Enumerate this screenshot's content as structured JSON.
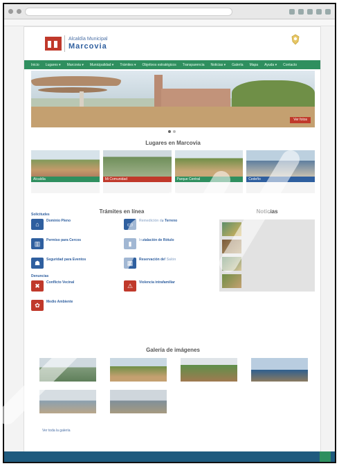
{
  "colors": {
    "nav_green": "#2f8f5f",
    "brand_red": "#c0392b",
    "brand_blue": "#2f5f9f",
    "footer_blue": "#1f5a7e"
  },
  "icons": {
    "logo": "building-icon",
    "crest": "crest-icon",
    "watermark": "watermark"
  },
  "header": {
    "subtitle": "Alcaldía Municipal",
    "title": "Marcovia"
  },
  "nav": {
    "items": [
      "Inicio",
      "Lugares ▾",
      "Marcovia ▾",
      "Municipalidad ▾",
      "Trámites ▾",
      "Objetivos estratégicos",
      "Transparencia",
      "Noticias ▾",
      "Galería",
      "Mapa",
      "Ayuda ▾",
      "Contacto"
    ]
  },
  "hero": {
    "tag": "Ver fotos"
  },
  "lugares": {
    "title": "Lugares en Marcovia",
    "items": [
      {
        "name": "Alcaldía"
      },
      {
        "name": "Mi Comunidad"
      },
      {
        "name": "Parque Central"
      },
      {
        "name": "Cedeño"
      }
    ]
  },
  "tramites": {
    "title": "Trámites en línea",
    "group1": "Solicitudes",
    "group2": "Denuncias",
    "items": [
      {
        "title": "Dominio Pleno",
        "icon": "house-icon"
      },
      {
        "title": "Remedición de Terreno",
        "icon": "map-icon"
      },
      {
        "title": "Permiso para Cercos",
        "icon": "fence-icon"
      },
      {
        "title": "Instalación de Rótulo",
        "icon": "sign-icon"
      },
      {
        "title": "Seguridad para Eventos",
        "icon": "event-icon"
      },
      {
        "title": "Reservación del Salón",
        "icon": "hall-icon"
      }
    ],
    "denuncias": [
      {
        "title": "Conflicto Vecinal",
        "icon": "conflict-icon"
      },
      {
        "title": "Violencia intrafamiliar",
        "icon": "violence-icon"
      },
      {
        "title": "Medio Ambiente",
        "icon": "environment-icon"
      }
    ]
  },
  "noticias": {
    "title": "Noticias"
  },
  "galeria": {
    "title": "Galería de imágenes",
    "more": "Ver toda la galería"
  }
}
